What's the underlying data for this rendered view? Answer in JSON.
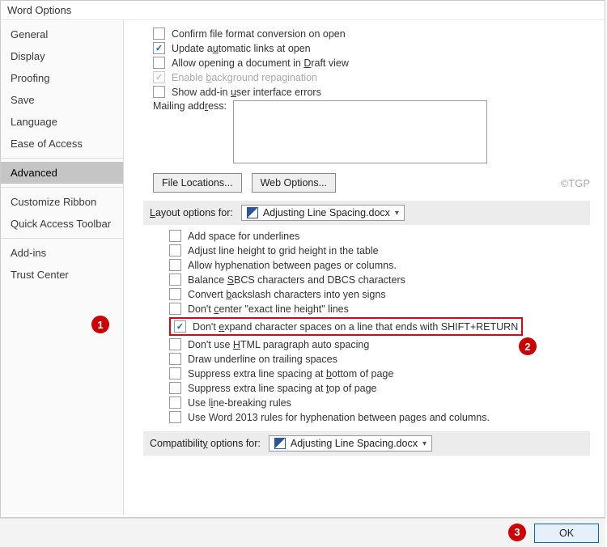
{
  "title": "Word Options",
  "sidebar": {
    "items": [
      {
        "label": "General"
      },
      {
        "label": "Display"
      },
      {
        "label": "Proofing"
      },
      {
        "label": "Save"
      },
      {
        "label": "Language"
      },
      {
        "label": "Ease of Access"
      },
      {
        "label": "Advanced"
      },
      {
        "label": "Customize Ribbon"
      },
      {
        "label": "Quick Access Toolbar"
      },
      {
        "label": "Add-ins"
      },
      {
        "label": "Trust Center"
      }
    ]
  },
  "top": {
    "confirm": "Confirm file format conversion on open",
    "update_pre": "Update a",
    "update_accel": "u",
    "update_post": "tomatic links at open",
    "draft_pre": "Allow opening a document in ",
    "draft_accel": "D",
    "draft_post": "raft view",
    "repag_pre": "Enable ",
    "repag_accel": "b",
    "repag_post": "ackground repagination",
    "addin_pre": "Show add-in ",
    "addin_accel": "u",
    "addin_post": "ser interface errors",
    "mailing_label": "Mailing add",
    "mailing_accel": "r",
    "mailing_post": "ess:",
    "file_loc_accel": "F",
    "file_loc_post": "ile Locations...",
    "web_opt_pre": "Web ",
    "web_opt_accel": "O",
    "web_opt_post": "ptions...",
    "watermark": "©TGP"
  },
  "layout_hdr": {
    "pre": "",
    "accel": "L",
    "post": "ayout options for:",
    "doc": "Adjusting Line Spacing.docx"
  },
  "layout": [
    {
      "text": "Add space for underlines"
    },
    {
      "text": "Adjust line height to grid height in the table"
    },
    {
      "text": "Allow hyphenation between pages or columns."
    },
    {
      "pre": "Balance ",
      "accel": "S",
      "post": "BCS characters and DBCS characters"
    },
    {
      "pre": "Convert ",
      "accel": "b",
      "post": "ackslash characters into yen signs"
    },
    {
      "pre": "Don't ",
      "accel": "c",
      "post": "enter \"exact line height\" lines"
    },
    {
      "pre": "Don't ",
      "accel": "e",
      "post": "xpand character spaces on a line that ends with SHIFT+RETURN",
      "hl": true,
      "checked": true
    },
    {
      "pre": "Don't use ",
      "accel": "H",
      "post": "TML paragraph auto spacing"
    },
    {
      "text": "Draw underline on trailing spaces"
    },
    {
      "pre": "Suppress extra line spacing at ",
      "accel": "b",
      "post": "ottom of page"
    },
    {
      "pre": "Suppress extra line spacing at ",
      "accel": "t",
      "post": "op of page"
    },
    {
      "pre": "Use l",
      "accel": "i",
      "post": "ne-breaking rules"
    },
    {
      "text": "Use Word 2013 rules for hyphenation between pages and columns."
    }
  ],
  "compat_hdr": {
    "pre": "Compatibilit",
    "accel": "y",
    "post": " options for:",
    "doc": "Adjusting Line Spacing.docx"
  },
  "ok": "OK",
  "badges": {
    "b1": "1",
    "b2": "2",
    "b3": "3"
  }
}
